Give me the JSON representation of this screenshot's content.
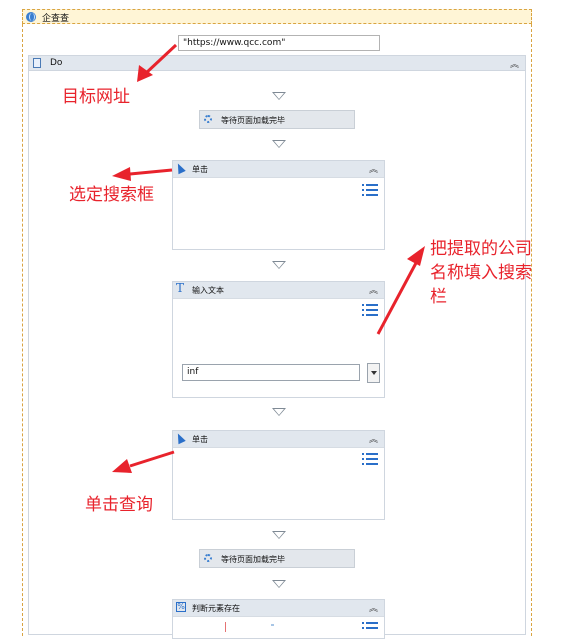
{
  "scope": {
    "title": "企查查"
  },
  "url": {
    "value": "\"https://www.qcc.com\""
  },
  "do": {
    "title": "Do"
  },
  "steps": {
    "wait1": "等待页面加载完毕",
    "click1": "单击",
    "type_text": "输入文本",
    "type_value": "inf",
    "click2": "单击",
    "wait2": "等待页面加载完毕",
    "element_exists": "判断元素存在"
  },
  "annotations": {
    "target_url": "目标网址",
    "select_search_box": "选定搜索框",
    "fill_line1": "把提取的公司",
    "fill_line2": "名称填入搜索",
    "fill_line3": "栏",
    "click_query": "单击查询"
  },
  "colors": {
    "annotation": "#e8232c",
    "accent": "#2a6fc9",
    "header": "#e1e7ee"
  }
}
